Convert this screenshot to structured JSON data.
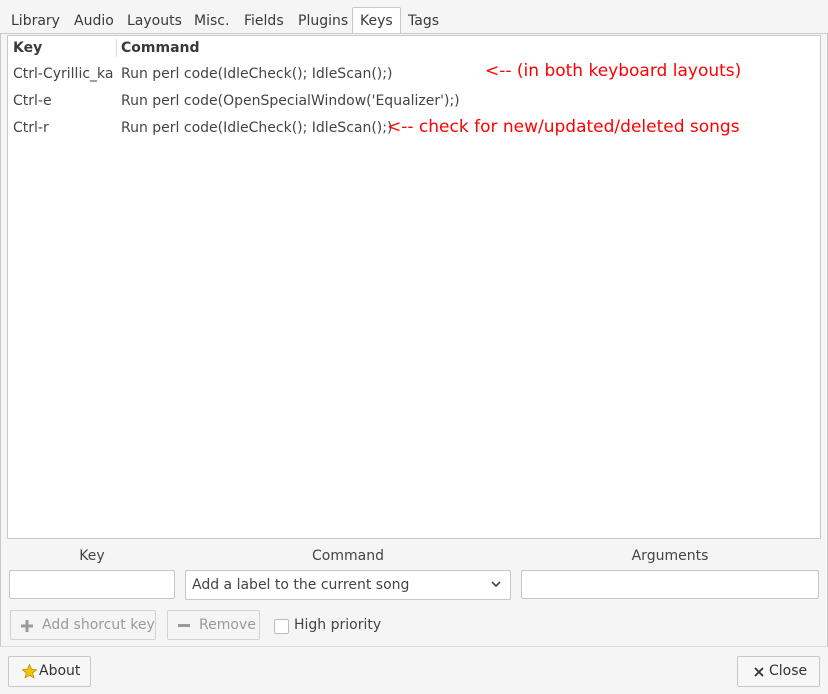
{
  "tabs": [
    "Library",
    "Audio",
    "Layouts",
    "Misc.",
    "Fields",
    "Plugins",
    "Keys",
    "Tags"
  ],
  "active_tab": "Keys",
  "table": {
    "columns": [
      "Key",
      "Command"
    ],
    "rows": [
      {
        "key": "Ctrl-Cyrillic_ka",
        "command": "Run perl code(IdleCheck(); IdleScan();)",
        "annotation": "<--  (in both keyboard layouts)"
      },
      {
        "key": "Ctrl-e",
        "command": "Run perl code(OpenSpecialWindow('Equalizer');)",
        "annotation": ""
      },
      {
        "key": "Ctrl-r",
        "command": "Run perl code(IdleCheck(); IdleScan();)",
        "annotation": "<-- check for new/updated/deleted songs"
      }
    ]
  },
  "editor": {
    "key_label": "Key",
    "command_label": "Command",
    "arguments_label": "Arguments",
    "key_value": "",
    "command_selected": "Add a label to the current song",
    "arguments_value": ""
  },
  "actions": {
    "add_label": "Add shorcut key",
    "remove_label": "Remove",
    "priority_label": "High priority"
  },
  "footer": {
    "about_label": "About",
    "close_label": "Close"
  },
  "colors": {
    "annotation": "#ff0000",
    "star": "#f5c400"
  }
}
